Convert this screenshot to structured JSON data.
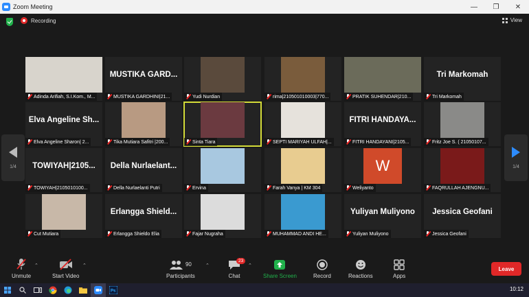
{
  "window": {
    "title": "Zoom Meeting"
  },
  "topbar": {
    "recording_label": "Recording",
    "view_label": "View"
  },
  "pager": {
    "left_page": "1/4",
    "right_page": "1/4"
  },
  "tiles": [
    {
      "label": "Adinda Arifiah, S.I.Kom., M...",
      "bigname": "",
      "photo": "#d8d4cc"
    },
    {
      "label": "MUSTIKA GARDHINI|21...",
      "bigname": "MUSTIKA  GARD...",
      "photo": ""
    },
    {
      "label": "Yudi Nurdian",
      "bigname": "",
      "photo": "#5a4a3c"
    },
    {
      "label": "rima|210501010003|770...",
      "bigname": "",
      "photo": "#7a5c3c"
    },
    {
      "label": "PRATIK SUHENDAR|210...",
      "bigname": "",
      "photo": "#6b6b5a"
    },
    {
      "label": "Tri Markomah",
      "bigname": "Tri Markomah",
      "photo": ""
    },
    {
      "label": "Elva Angeline Sharon| 2...",
      "bigname": "Elva Angeline Sh...",
      "photo": ""
    },
    {
      "label": "Tika Mutiara Safitri |200...",
      "bigname": "",
      "photo": "#b89a82"
    },
    {
      "label": "Sinta Tiara",
      "bigname": "",
      "photo": "#6b3a40"
    },
    {
      "label": "SEPTI MARIYAH ULFAH|...",
      "bigname": "",
      "photo": "#e6e2dc"
    },
    {
      "label": "FITRI HANDAYANI|2105...",
      "bigname": "FITRI  HANDAYA...",
      "photo": ""
    },
    {
      "label": "Fritz Joe S. ( 21050107...",
      "bigname": "",
      "photo": "#8a8a88"
    },
    {
      "label": "TOWIYAH|2105010100...",
      "bigname": "TOWIYAH|2105...",
      "photo": ""
    },
    {
      "label": "Della Nurlaelanti Putri",
      "bigname": "Della  Nurlaelant...",
      "photo": ""
    },
    {
      "label": "Ervina",
      "bigname": "",
      "photo": "#a8c8e0"
    },
    {
      "label": "Farah Vanya | KM 304",
      "bigname": "",
      "photo": "#e8cc90"
    },
    {
      "label": "Weliyanto",
      "bigname": "",
      "photo": "#d04a2a"
    },
    {
      "label": "FAQRULLAH AJENGNU...",
      "bigname": "",
      "photo": "#7a1a1a"
    },
    {
      "label": "Cut Mutiara",
      "bigname": "",
      "photo": "#c8b8a8"
    },
    {
      "label": "Erlangga Shieldo Elia",
      "bigname": "Erlangga  Shield...",
      "photo": ""
    },
    {
      "label": "Fajar Nugraha",
      "bigname": "",
      "photo": "#dcdcdc"
    },
    {
      "label": "MUHAMMAD ANDI HE...",
      "bigname": "",
      "photo": "#3a9ad0"
    },
    {
      "label": "Yuliyan Muliyono",
      "bigname": "Yuliyan Muliyono",
      "photo": ""
    },
    {
      "label": "Jessica Geofani",
      "bigname": "Jessica Geofani",
      "photo": ""
    }
  ],
  "weliyanto_initial": "W",
  "toolbar": {
    "unmute": "Unmute",
    "start_video": "Start Video",
    "participants": "Participants",
    "participants_count": "90",
    "chat": "Chat",
    "chat_badge": "23",
    "share_screen": "Share Screen",
    "record": "Record",
    "reactions": "Reactions",
    "apps": "Apps",
    "leave": "Leave"
  },
  "taskbar": {
    "clock": "10:12"
  },
  "colors": {
    "accent": "#2d8cff",
    "share_green": "#21b14b",
    "leave_red": "#e02828",
    "active_speaker": "#d4dc38"
  }
}
